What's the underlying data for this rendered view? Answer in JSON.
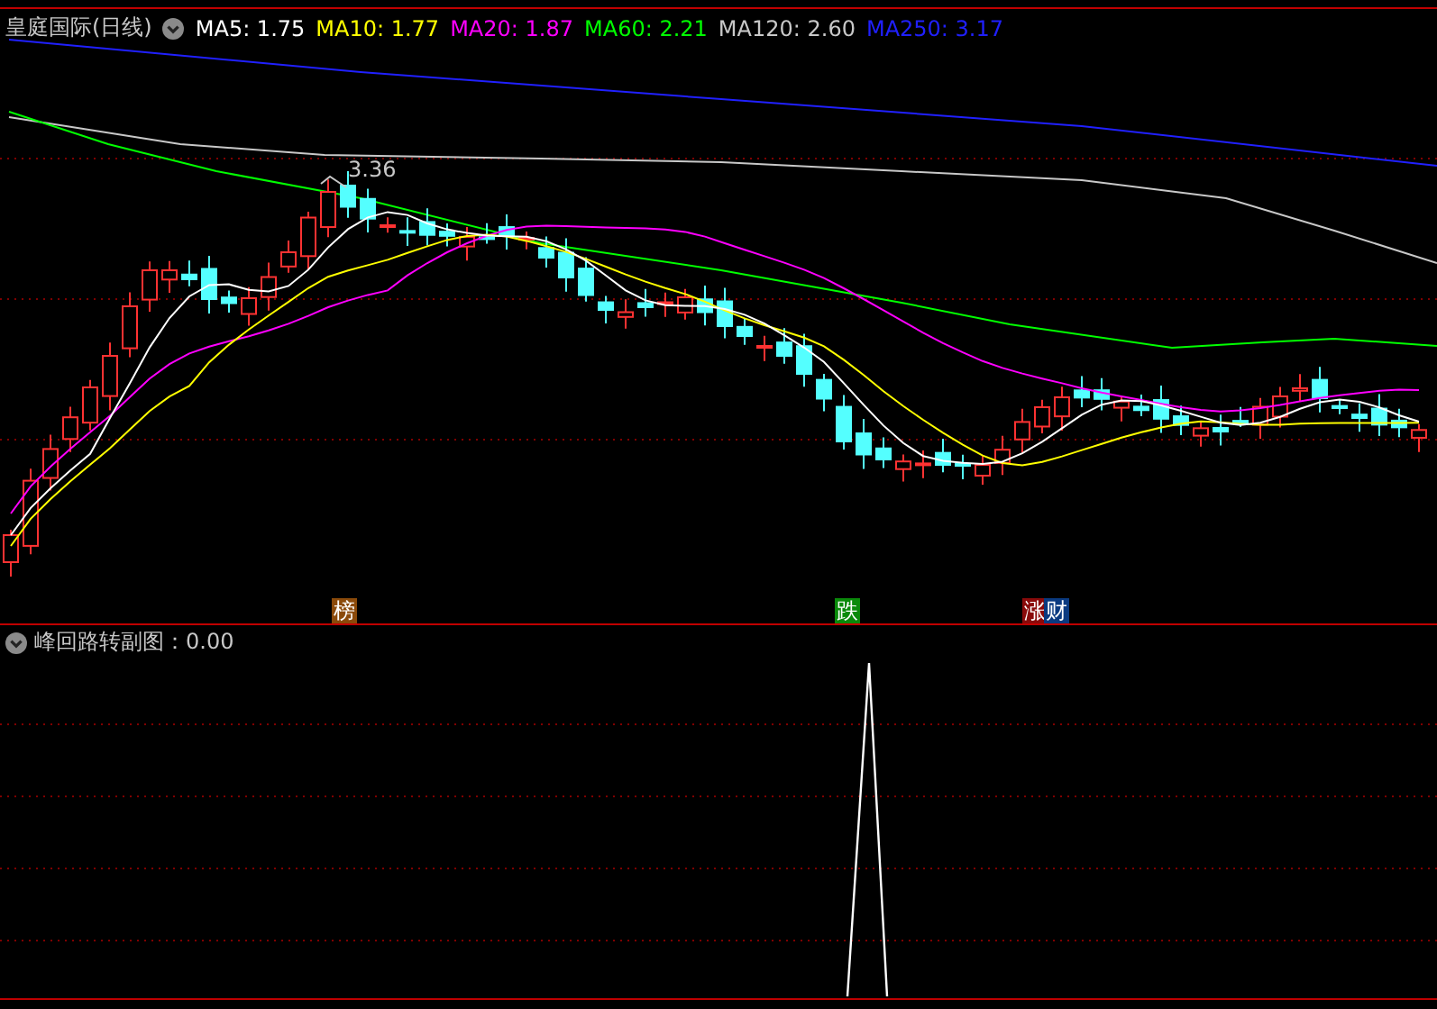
{
  "chart": {
    "title": "皇庭国际(日线)",
    "ma_legend": [
      {
        "label": "MA5: 1.75",
        "color": "#ffffff"
      },
      {
        "label": "MA10: 1.77",
        "color": "#ffff00"
      },
      {
        "label": "MA20: 1.87",
        "color": "#ff00ff"
      },
      {
        "label": "MA60: 2.21",
        "color": "#00ff00"
      },
      {
        "label": "MA120: 2.60",
        "color": "#c8c8c8"
      },
      {
        "label": "MA250: 3.17",
        "color": "#2020ff"
      }
    ],
    "high_label": "3.36",
    "signals": [
      {
        "text": "榜",
        "color": "#8b4a0a"
      },
      {
        "text": "跌",
        "color": "#0a8a0a"
      },
      {
        "text": "涨",
        "color": "#8a0a0a"
      },
      {
        "text": "财",
        "color": "#0a3a80"
      }
    ]
  },
  "indicator": {
    "title": "峰回路转副图：0.00"
  }
}
